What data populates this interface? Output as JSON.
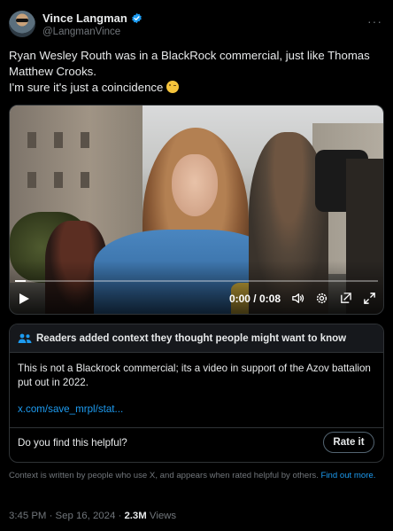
{
  "author": {
    "name": "Vince Langman",
    "handle": "@LangmanVince",
    "verified_color": "#1d9bf0"
  },
  "tweet": {
    "line1": "Ryan Wesley Routh was in a BlackRock commercial, just like Thomas Matthew Crooks.",
    "line2": "I'm sure it's just a coincidence",
    "emoji": "winking-face"
  },
  "video": {
    "time": "0:00 / 0:08",
    "progress_fraction": 0.03,
    "play_icon": "play-icon",
    "controls": [
      "volume-icon",
      "settings-icon",
      "popout-icon",
      "fullscreen-icon"
    ]
  },
  "community_note": {
    "title": "Readers added context they thought people might want to know",
    "body": "This is not a Blackrock commercial; its a video in support of the Azov battalion put out in 2022.",
    "link": "x.com/save_mrpl/stat...",
    "helpful_question": "Do you find this helpful?",
    "rate_label": "Rate it"
  },
  "context_footer": {
    "text": "Context is written by people who use X, and appears when rated helpful by others.",
    "link": "Find out more."
  },
  "meta": {
    "time": "3:45 PM · Sep 16, 2024 · ",
    "views_count": "2.3M",
    "views_label": " Views"
  },
  "colors": {
    "background": "#000000",
    "accent": "#1d9bf0",
    "muted": "#71767b",
    "border": "#2f3336"
  }
}
